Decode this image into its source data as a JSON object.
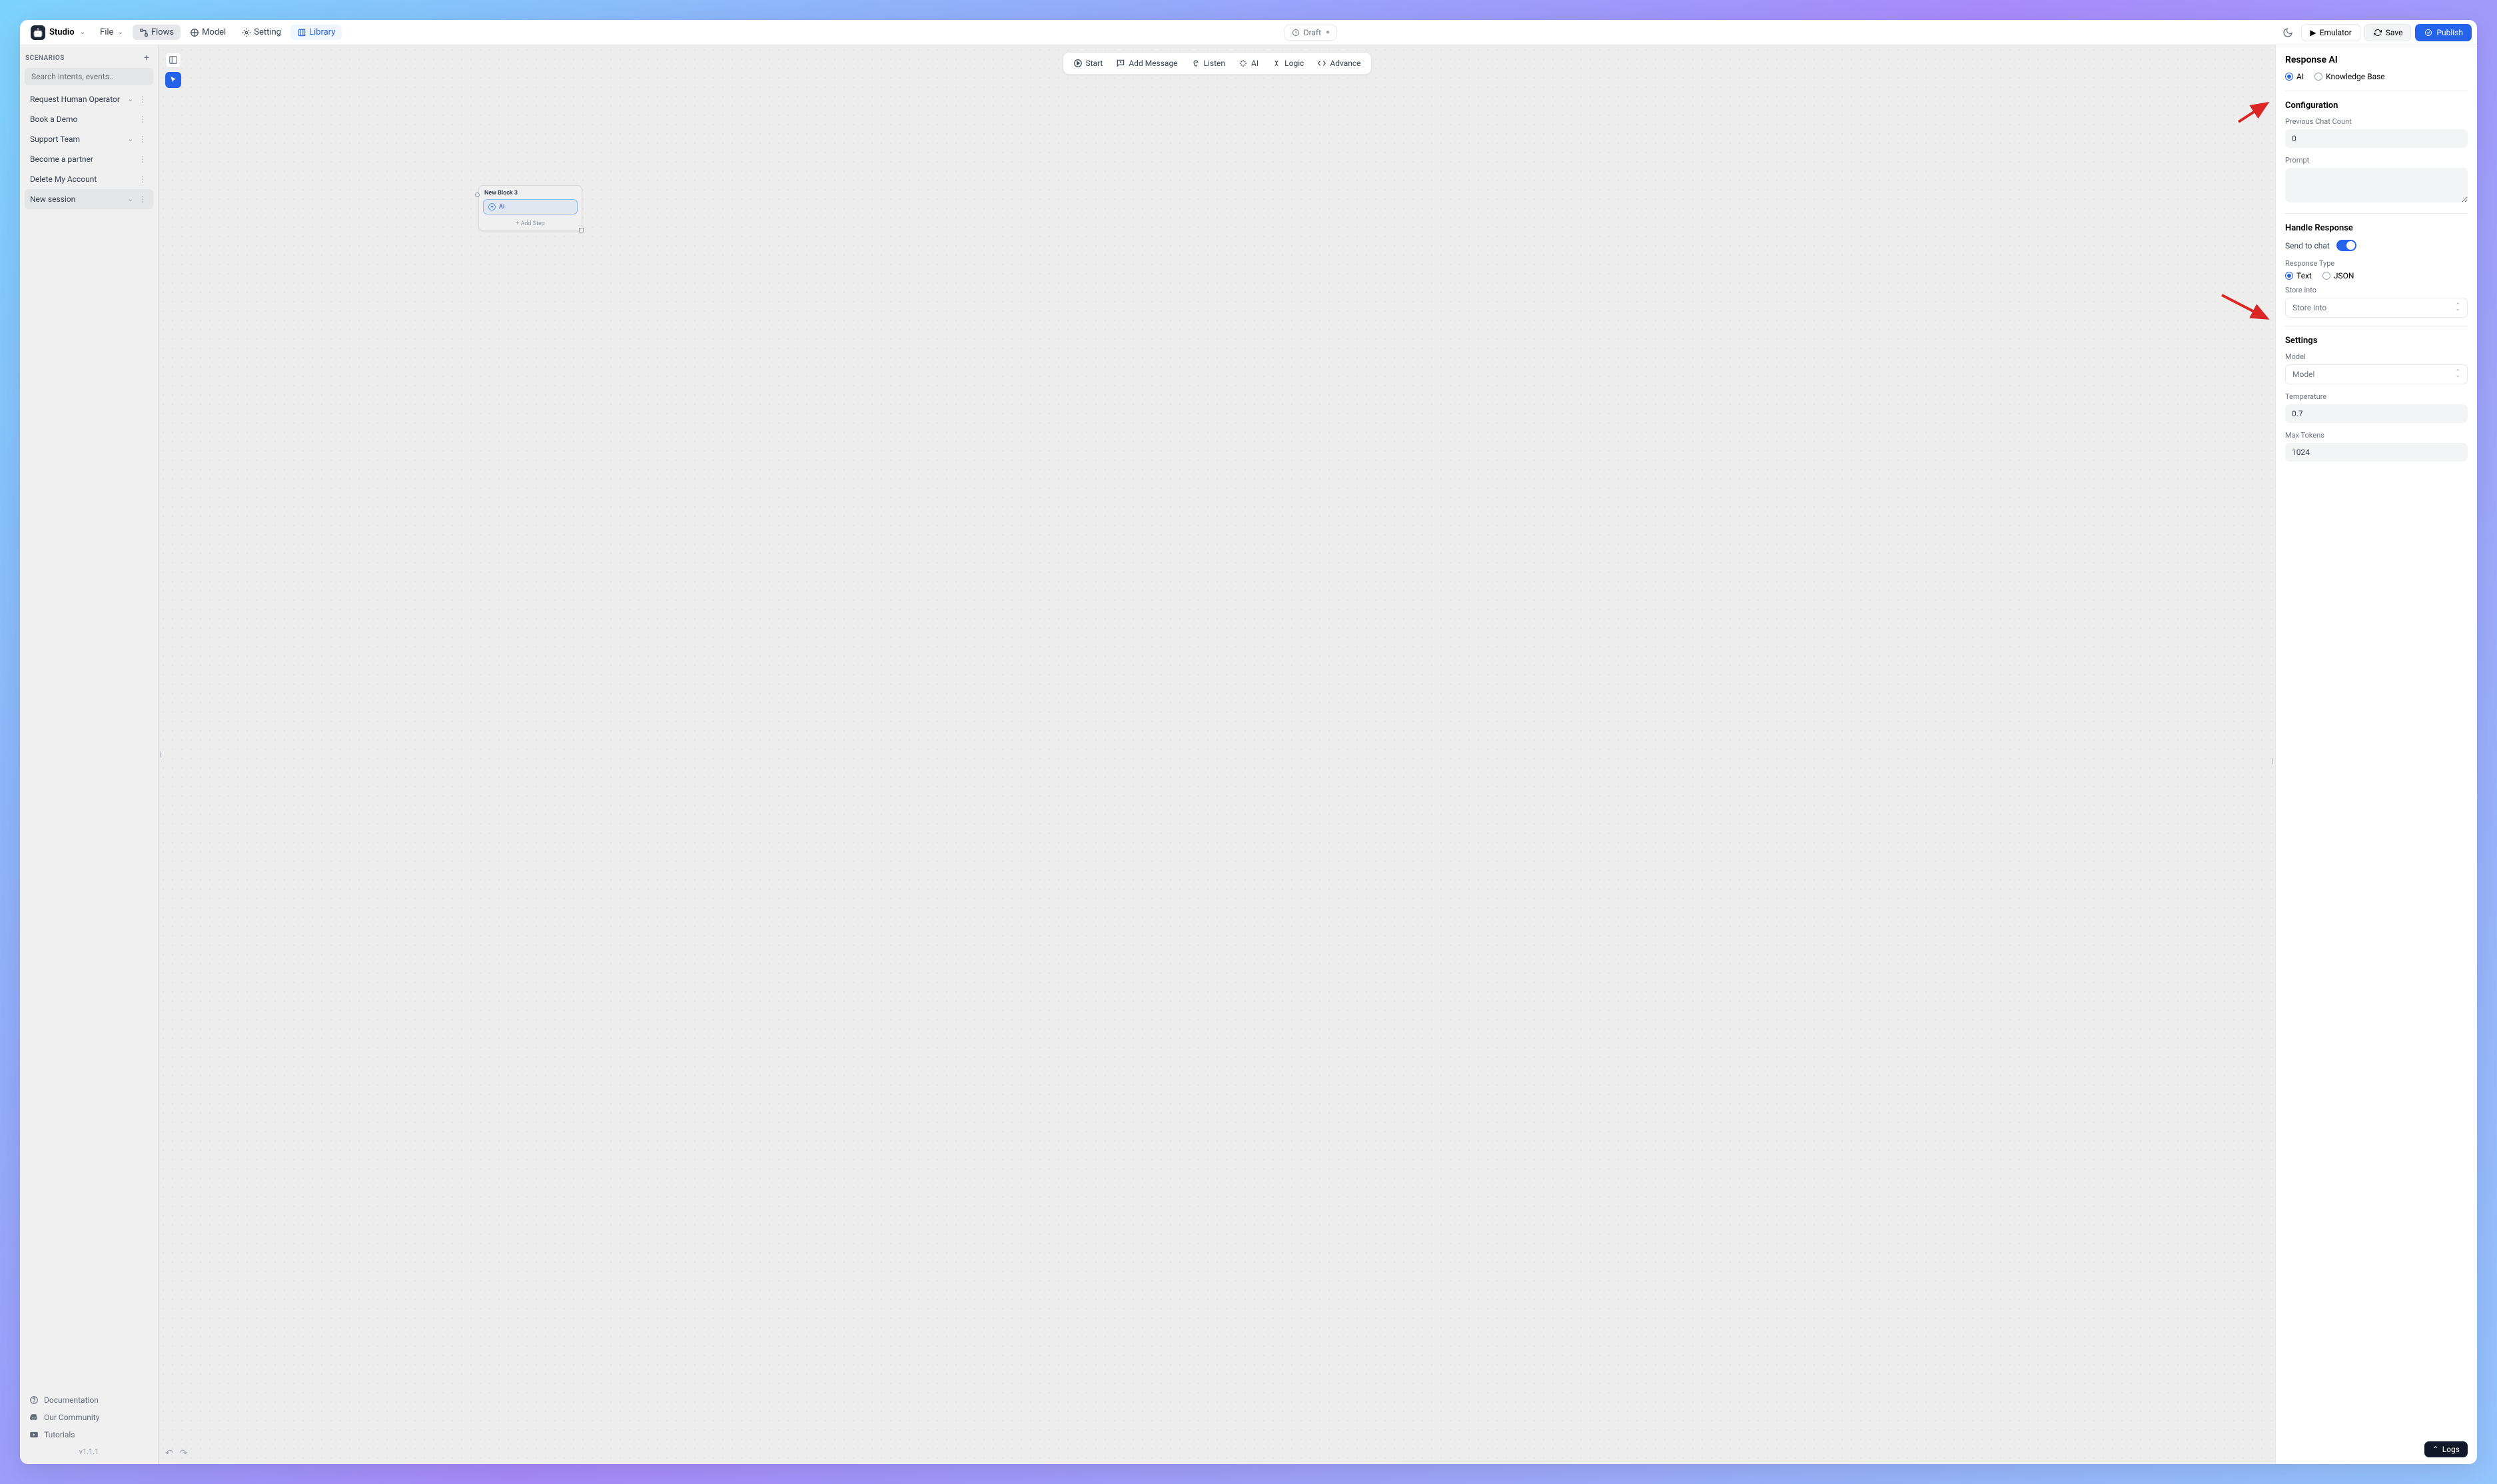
{
  "brand": "Studio",
  "menus": {
    "file": "File",
    "flows": "Flows",
    "model": "Model",
    "setting": "Setting",
    "library": "Library"
  },
  "draft": "Draft",
  "topActions": {
    "emulator": "Emulator",
    "save": "Save",
    "publish": "Publish"
  },
  "sidebar": {
    "label": "SCENARIOS",
    "searchPlaceholder": "Search intents, events..",
    "items": [
      {
        "label": "Request Human Operator",
        "expandable": true
      },
      {
        "label": "Book a Demo",
        "expandable": false
      },
      {
        "label": "Support Team",
        "expandable": true
      },
      {
        "label": "Become a partner",
        "expandable": false
      },
      {
        "label": "Delete My Account",
        "expandable": false
      },
      {
        "label": "New session",
        "expandable": true
      }
    ],
    "footer": {
      "docs": "Documentation",
      "community": "Our Community",
      "tutorials": "Tutorials"
    },
    "version": "v1.1.1"
  },
  "canvasActions": {
    "start": "Start",
    "addMessage": "Add Message",
    "listen": "Listen",
    "ai": "AI",
    "logic": "Logic",
    "advance": "Advance"
  },
  "block": {
    "title": "New Block 3",
    "step": "AI",
    "add": "+  Add Step"
  },
  "panel": {
    "title": "Response AI",
    "radios": {
      "ai": "AI",
      "kb": "Knowledge Base"
    },
    "config": {
      "title": "Configuration",
      "prevChatLabel": "Previous Chat Count",
      "prevChatValue": "0",
      "promptLabel": "Prompt"
    },
    "handle": {
      "title": "Handle Response",
      "sendLabel": "Send to chat",
      "respTypeLabel": "Response Type",
      "text": "Text",
      "json": "JSON",
      "storeLabel": "Store into",
      "storePlaceholder": "Store into"
    },
    "settings": {
      "title": "Settings",
      "modelLabel": "Model",
      "modelPlaceholder": "Model",
      "tempLabel": "Temperature",
      "tempValue": "0.7",
      "tokensLabel": "Max Tokens",
      "tokensValue": "1024"
    }
  },
  "logs": "Logs"
}
